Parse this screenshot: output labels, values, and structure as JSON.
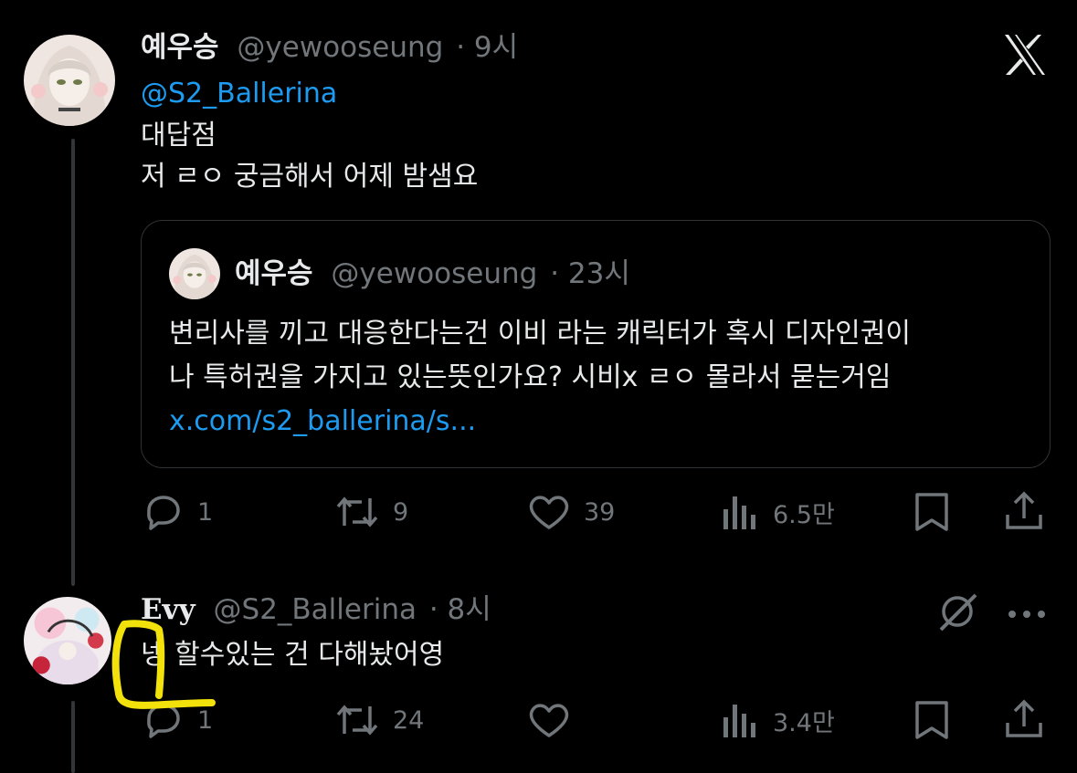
{
  "colors": {
    "background": "#000000",
    "text": "#e7e9ea",
    "muted": "#71767b",
    "link": "#1d9bf0",
    "highlight": "#f2e10a"
  },
  "tweet1": {
    "display_name": "예우승",
    "handle": "@yewooseung",
    "time": "· 9시",
    "mention": "@S2_Ballerina",
    "lines": [
      "대답점",
      "저 ㄹㅇ 궁금해서 어제 밤샘요"
    ],
    "quote": {
      "display_name": "예우승",
      "handle": "@yewooseung",
      "time": "· 23시",
      "lines": [
        "변리사를 끼고 대응한다는건 이비 라는 캐릭터가 혹시 디자인권이",
        "나 특허권을 가지고 있는뜻인가요? 시비x ㄹㅇ 몰라서 묻는거임"
      ],
      "link": "x.com/s2_ballerina/s..."
    },
    "actions": {
      "replies": "1",
      "reposts": "9",
      "likes": "39",
      "views": "6.5만"
    },
    "brand_icon": "x-logo-icon"
  },
  "tweet2": {
    "display_name": "Evy",
    "handle": "@S2_Ballerina",
    "time": "· 8시",
    "text": "넹 할수있는 건 다해놨어영",
    "actions": {
      "replies": "1",
      "reposts": "24",
      "likes": "",
      "views": "3.4만"
    }
  }
}
